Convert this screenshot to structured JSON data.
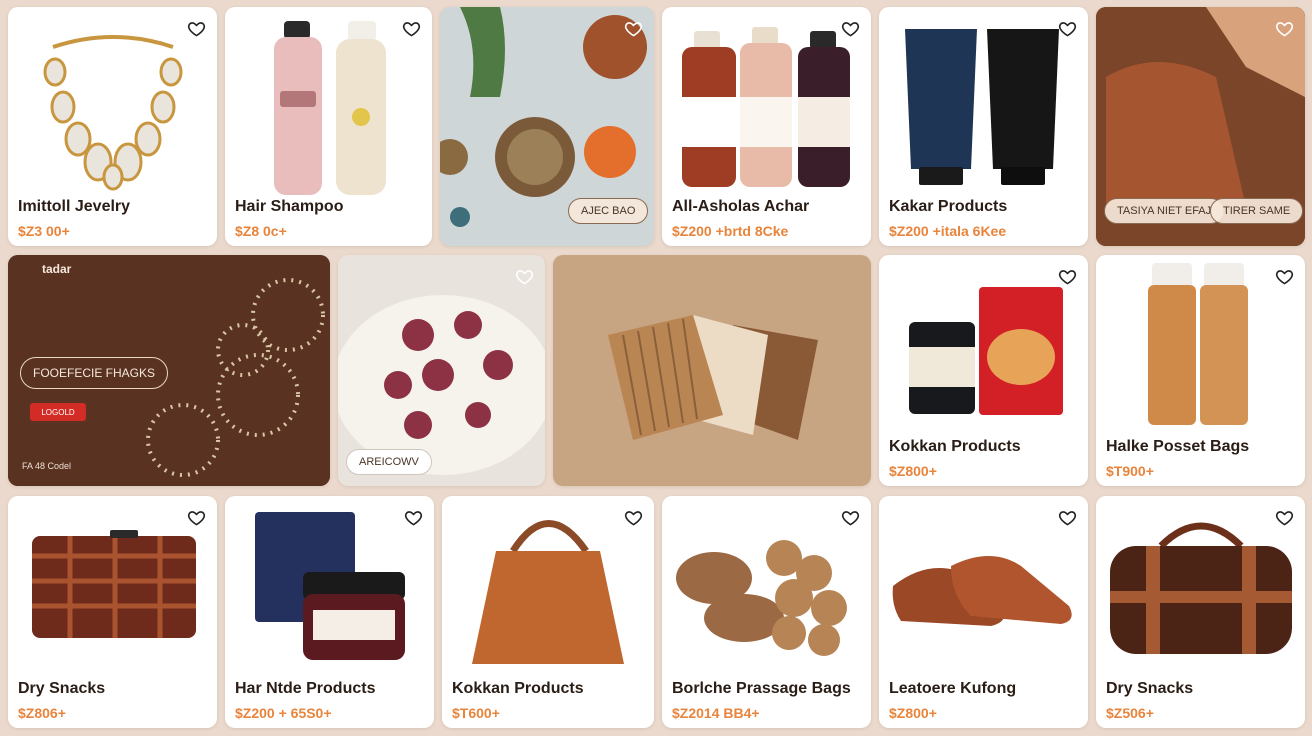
{
  "colors": {
    "background": "#ead9cc",
    "price": "#e8843b",
    "title": "#2a1d16"
  },
  "icons": {
    "favorite": "heart-outline-icon"
  },
  "row1": [
    {
      "title": "Imittoll Jevelry",
      "price": "$Z3 00+"
    },
    {
      "title": "Hair Shampoo",
      "price": "$Z8 0c+"
    },
    {
      "pill_left": "AJEC BAO"
    },
    {
      "title": "All-Asholas Achar",
      "price": "$Z200 +brtd 8Cke"
    },
    {
      "title": "Kakar Products",
      "price": "$Z200 +itala 6Kee"
    },
    {
      "pill_left": "TASIYA NIET EFAJ",
      "pill_right": "TIRER SAME"
    }
  ],
  "row2": {
    "banner": {
      "brand": "tadar",
      "button": "FOOEFECIE FHAGKS",
      "tag": "LOGOLD",
      "footer": "FA 48 Codel"
    },
    "food_card": {
      "tag": "AREICOWV"
    },
    "products": [
      {
        "title": "Kokkan Products",
        "price": "$Z800+"
      },
      {
        "title": "Halke Posset Bags",
        "price": "$T900+"
      }
    ]
  },
  "row3": [
    {
      "title": "Dry Snacks",
      "price": "$Z806+"
    },
    {
      "title": "Har Ntde Products",
      "price": "$Z200 + 65S0+"
    },
    {
      "title": "Kokkan Products",
      "price": "$T600+"
    },
    {
      "title": "Borlche Prassage Bags",
      "price": "$Z2014 BB4+"
    },
    {
      "title": "Leatoere Kufong",
      "price": "$Z800+"
    },
    {
      "title": "Dry Snacks",
      "price": "$Z506+"
    }
  ]
}
